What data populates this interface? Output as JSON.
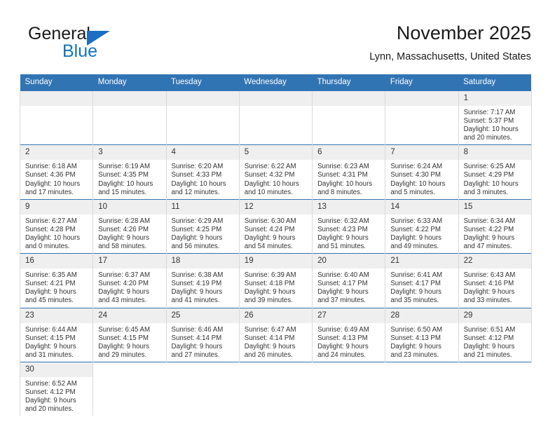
{
  "brand": {
    "name_top": "General",
    "name_bottom": "Blue",
    "accent_color": "#1b6ec2",
    "blue_text_color": "#1274bc"
  },
  "header": {
    "title": "November 2025",
    "subtitle": "Lynn, Massachusetts, United States"
  },
  "theme": {
    "header_blue": "#3174b4",
    "daynum_band": "#efefef",
    "cell_border": "#d9d9d9",
    "text": "#333333"
  },
  "calendar": {
    "weekday_headers": [
      "Sunday",
      "Monday",
      "Tuesday",
      "Wednesday",
      "Thursday",
      "Friday",
      "Saturday"
    ],
    "weeks": [
      [
        {
          "day": "",
          "lines": []
        },
        {
          "day": "",
          "lines": []
        },
        {
          "day": "",
          "lines": []
        },
        {
          "day": "",
          "lines": []
        },
        {
          "day": "",
          "lines": []
        },
        {
          "day": "",
          "lines": []
        },
        {
          "day": "1",
          "lines": [
            "Sunrise: 7:17 AM",
            "Sunset: 5:37 PM",
            "Daylight: 10 hours",
            "and 20 minutes."
          ]
        }
      ],
      [
        {
          "day": "2",
          "lines": [
            "Sunrise: 6:18 AM",
            "Sunset: 4:36 PM",
            "Daylight: 10 hours",
            "and 17 minutes."
          ]
        },
        {
          "day": "3",
          "lines": [
            "Sunrise: 6:19 AM",
            "Sunset: 4:35 PM",
            "Daylight: 10 hours",
            "and 15 minutes."
          ]
        },
        {
          "day": "4",
          "lines": [
            "Sunrise: 6:20 AM",
            "Sunset: 4:33 PM",
            "Daylight: 10 hours",
            "and 12 minutes."
          ]
        },
        {
          "day": "5",
          "lines": [
            "Sunrise: 6:22 AM",
            "Sunset: 4:32 PM",
            "Daylight: 10 hours",
            "and 10 minutes."
          ]
        },
        {
          "day": "6",
          "lines": [
            "Sunrise: 6:23 AM",
            "Sunset: 4:31 PM",
            "Daylight: 10 hours",
            "and 8 minutes."
          ]
        },
        {
          "day": "7",
          "lines": [
            "Sunrise: 6:24 AM",
            "Sunset: 4:30 PM",
            "Daylight: 10 hours",
            "and 5 minutes."
          ]
        },
        {
          "day": "8",
          "lines": [
            "Sunrise: 6:25 AM",
            "Sunset: 4:29 PM",
            "Daylight: 10 hours",
            "and 3 minutes."
          ]
        }
      ],
      [
        {
          "day": "9",
          "lines": [
            "Sunrise: 6:27 AM",
            "Sunset: 4:28 PM",
            "Daylight: 10 hours",
            "and 0 minutes."
          ]
        },
        {
          "day": "10",
          "lines": [
            "Sunrise: 6:28 AM",
            "Sunset: 4:26 PM",
            "Daylight: 9 hours",
            "and 58 minutes."
          ]
        },
        {
          "day": "11",
          "lines": [
            "Sunrise: 6:29 AM",
            "Sunset: 4:25 PM",
            "Daylight: 9 hours",
            "and 56 minutes."
          ]
        },
        {
          "day": "12",
          "lines": [
            "Sunrise: 6:30 AM",
            "Sunset: 4:24 PM",
            "Daylight: 9 hours",
            "and 54 minutes."
          ]
        },
        {
          "day": "13",
          "lines": [
            "Sunrise: 6:32 AM",
            "Sunset: 4:23 PM",
            "Daylight: 9 hours",
            "and 51 minutes."
          ]
        },
        {
          "day": "14",
          "lines": [
            "Sunrise: 6:33 AM",
            "Sunset: 4:22 PM",
            "Daylight: 9 hours",
            "and 49 minutes."
          ]
        },
        {
          "day": "15",
          "lines": [
            "Sunrise: 6:34 AM",
            "Sunset: 4:22 PM",
            "Daylight: 9 hours",
            "and 47 minutes."
          ]
        }
      ],
      [
        {
          "day": "16",
          "lines": [
            "Sunrise: 6:35 AM",
            "Sunset: 4:21 PM",
            "Daylight: 9 hours",
            "and 45 minutes."
          ]
        },
        {
          "day": "17",
          "lines": [
            "Sunrise: 6:37 AM",
            "Sunset: 4:20 PM",
            "Daylight: 9 hours",
            "and 43 minutes."
          ]
        },
        {
          "day": "18",
          "lines": [
            "Sunrise: 6:38 AM",
            "Sunset: 4:19 PM",
            "Daylight: 9 hours",
            "and 41 minutes."
          ]
        },
        {
          "day": "19",
          "lines": [
            "Sunrise: 6:39 AM",
            "Sunset: 4:18 PM",
            "Daylight: 9 hours",
            "and 39 minutes."
          ]
        },
        {
          "day": "20",
          "lines": [
            "Sunrise: 6:40 AM",
            "Sunset: 4:17 PM",
            "Daylight: 9 hours",
            "and 37 minutes."
          ]
        },
        {
          "day": "21",
          "lines": [
            "Sunrise: 6:41 AM",
            "Sunset: 4:17 PM",
            "Daylight: 9 hours",
            "and 35 minutes."
          ]
        },
        {
          "day": "22",
          "lines": [
            "Sunrise: 6:43 AM",
            "Sunset: 4:16 PM",
            "Daylight: 9 hours",
            "and 33 minutes."
          ]
        }
      ],
      [
        {
          "day": "23",
          "lines": [
            "Sunrise: 6:44 AM",
            "Sunset: 4:15 PM",
            "Daylight: 9 hours",
            "and 31 minutes."
          ]
        },
        {
          "day": "24",
          "lines": [
            "Sunrise: 6:45 AM",
            "Sunset: 4:15 PM",
            "Daylight: 9 hours",
            "and 29 minutes."
          ]
        },
        {
          "day": "25",
          "lines": [
            "Sunrise: 6:46 AM",
            "Sunset: 4:14 PM",
            "Daylight: 9 hours",
            "and 27 minutes."
          ]
        },
        {
          "day": "26",
          "lines": [
            "Sunrise: 6:47 AM",
            "Sunset: 4:14 PM",
            "Daylight: 9 hours",
            "and 26 minutes."
          ]
        },
        {
          "day": "27",
          "lines": [
            "Sunrise: 6:49 AM",
            "Sunset: 4:13 PM",
            "Daylight: 9 hours",
            "and 24 minutes."
          ]
        },
        {
          "day": "28",
          "lines": [
            "Sunrise: 6:50 AM",
            "Sunset: 4:13 PM",
            "Daylight: 9 hours",
            "and 23 minutes."
          ]
        },
        {
          "day": "29",
          "lines": [
            "Sunrise: 6:51 AM",
            "Sunset: 4:12 PM",
            "Daylight: 9 hours",
            "and 21 minutes."
          ]
        }
      ],
      [
        {
          "day": "30",
          "lines": [
            "Sunrise: 6:52 AM",
            "Sunset: 4:12 PM",
            "Daylight: 9 hours",
            "and 20 minutes."
          ]
        },
        {
          "day": "",
          "lines": []
        },
        {
          "day": "",
          "lines": []
        },
        {
          "day": "",
          "lines": []
        },
        {
          "day": "",
          "lines": []
        },
        {
          "day": "",
          "lines": []
        },
        {
          "day": "",
          "lines": []
        }
      ]
    ]
  }
}
